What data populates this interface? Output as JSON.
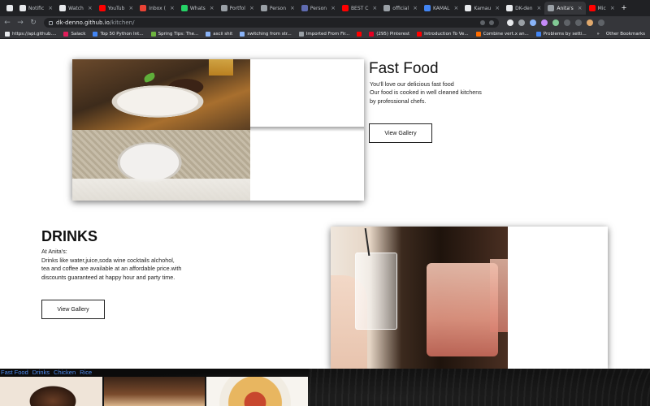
{
  "browser": {
    "tabs": [
      {
        "label": "",
        "active": false,
        "color": "#e8eaed"
      },
      {
        "label": "Notific",
        "active": false,
        "color": "#e8eaed"
      },
      {
        "label": "Watch",
        "active": false,
        "color": "#e8eaed"
      },
      {
        "label": "YouTub",
        "active": false,
        "color": "#ff0000"
      },
      {
        "label": "Inbox (",
        "active": false,
        "color": "#ea4335"
      },
      {
        "label": "Whats",
        "active": false,
        "color": "#25d366"
      },
      {
        "label": "Portfol",
        "active": false,
        "color": "#9aa0a6"
      },
      {
        "label": "Person",
        "active": false,
        "color": "#9aa0a6"
      },
      {
        "label": "Person",
        "active": false,
        "color": "#5f6bb0"
      },
      {
        "label": "BEST C",
        "active": false,
        "color": "#ff0000"
      },
      {
        "label": "official",
        "active": false,
        "color": "#9aa0a6"
      },
      {
        "label": "KAMAL",
        "active": false,
        "color": "#4285f4"
      },
      {
        "label": "Kamau",
        "active": false,
        "color": "#e8eaed"
      },
      {
        "label": "DK-den",
        "active": false,
        "color": "#e8eaed"
      },
      {
        "label": "Anita's",
        "active": true,
        "color": "#9aa0a6"
      },
      {
        "label": "Mic",
        "active": false,
        "color": "#ff0000"
      }
    ],
    "new_tab": "+",
    "url_host": "dk-denno.github.io",
    "url_path": "/kitchen/",
    "bookmarks": [
      {
        "label": "https://api.github....",
        "color": "#e8eaed"
      },
      {
        "label": "Salack",
        "color": "#e01e5a"
      },
      {
        "label": "Top 50 Python Int...",
        "color": "#4285f4"
      },
      {
        "label": "Spring Tips: The...",
        "color": "#6db33f"
      },
      {
        "label": "ascii shit",
        "color": "#8ab4f8"
      },
      {
        "label": "switching from str...",
        "color": "#8ab4f8"
      },
      {
        "label": "Imported From Fir...",
        "color": "#9aa0a6"
      },
      {
        "label": "",
        "color": "#ff0000"
      },
      {
        "label": "(295) Pinterest",
        "color": "#e60023"
      },
      {
        "label": "Introduction To Ve...",
        "color": "#ff0000"
      },
      {
        "label": "Combine vert.x an...",
        "color": "#ff6d00"
      },
      {
        "label": "Problems by setti...",
        "color": "#4285f4"
      }
    ],
    "bookmarks_more": "»",
    "other_bookmarks": "Other Bookmarks"
  },
  "fast_food": {
    "title": "Fast Food",
    "line1": "You'll love our delicious fast food",
    "line2": "Our food is cooked in well cleaned kitchens",
    "line3": "by professional chefs.",
    "button": "View Gallery"
  },
  "drinks": {
    "title": "DRINKS",
    "line1": "At Anita's:",
    "line2": "Drinks like water,juice,soda wine cocktails alchohol,",
    "line3": "tea and coffee are available at an affordable price.with",
    "line4": "discounts guaranteed at happy hour and party time.",
    "button": "View Gallery"
  },
  "bottom_nav": [
    "Fast Food",
    "Drinks",
    "Chicken",
    "Rice"
  ]
}
